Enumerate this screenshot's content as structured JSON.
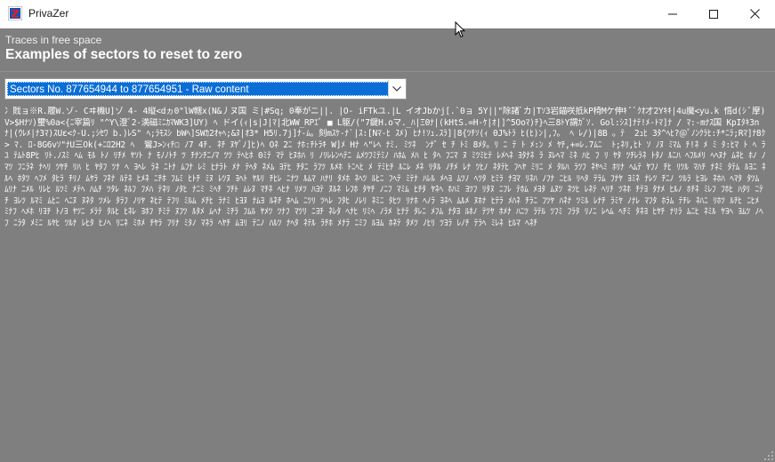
{
  "window": {
    "title": "PrivaZer",
    "icon": "privazer-logo-icon",
    "controls": [
      "minimize-icon",
      "maximize-icon",
      "close-icon"
    ]
  },
  "header": {
    "subtitle": "Traces in free space",
    "title": "Examples of sectors to reset to zero"
  },
  "sector_select": {
    "value": "Sectors No. 877654944 to 877654951 - Raw content"
  },
  "raw_content": "冫戝ョ※R.履W.ゾ- Cヰ機U]ゾ 4- 4縦<dヵ0\"lW轄x(N&丿ヌ国 ミ|#Sq; 0奉がニ||. |O- iFTkユ.|L イオJbかj[.`0ョ 5Y||\"除諸ﾞカ|Tｿ3岩錨咲抵kP椅Mケ伸ｷ ﾟﾟｸｵ才2Yｷｷ|4u魔<yu.k 惰d(ｼ ﾟ摩)V>$Hﾅｿ)璽%0a<{ﾆ宰篇ﾘ \"^Y\\澄ﾞ2-満磁ﾐﾆｶﾏWK3]UY) ﾍ ドイ(ｨ|s|J|ﾏ|北WW_RPｴﾞ ■ L躯/(\"7鍵H.oマ._ﾊ|Ξ0ﾅ|(kHtS.=H-ｹ|ｵ|]^5Ooﾏ)ﾁ}ﾍ三8ﾄY謂ｶﾞｿ. Gol:ｼｽ]ﾅﾃ!ﾒ-ﾄﾏ]ﾅ / ﾏ:-mﾅｽ国 KpIﾀｷ3nﾅ|(ｳﾚﾒ|ﾅ3ﾏ)ｽUε<ｸ-U.;ｼｾﾜ b.)ﾚS\" ﾍ;ﾗﾓｽｼ bWﾍ]SWｶ2ｵｬﾍ;&ﾇ|ｵ3* H5ﾘ.7j]ﾅ-ﾑ。刻mｽｹ-ﾅ`|ｽ:[Nﾏ-ﾋ ｽﾒ) ﾋﾅ!ｿｭ.ｽﾗ]|8{ﾂﾁｿ(ｨ 0J%ﾄﾗ ﾋ(ﾋ)ﾝ|,ﾌ。 ﾍ ﾚ/)|8B 。ﾃ  2ｭﾋ 3ﾀ^ﾍﾋ?@ﾟﾉﾝｸﾗﾋ:ﾁ*ﾆﾗ;Rﾏ]ﾅ8ｸ> ﾏ. ﾛ-8G6vｿ\"ﾅU三Ok(+ﾆﾛ2H2 ﾍ  鸞J>ﾝｨﾁ﾿ ﾉ7 4ﾁ. ﾈﾁ ﾇﾔﾞﾉ]ﾋ)ﾍ Oﾈ 2ﾆ ﾅﾎ:ﾁﾄﾗｷ W]ﾒ Hﾅ ﾍ\"ﾚﾍ ﾅﾐ. ﾐﾂﾈ  ﾝﾅ゜ｾ ﾁ ﾄﾐ 8ﾒﾀ。ﾘ ﾆ ﾃ ﾄ ﾒ:ﾝ ﾒ ﾔﾁ,+=ﾚ.7ﾑﾆ  ﾄ;ﾈﾘ,ﾋﾄ ｿ ﾉﾇ ﾐﾏﾑ ﾁ!ﾈ ﾒ ﾐ ﾀ:ﾋﾏ ﾄ ﾍ ﾗ ﾕ ﾃﾑﾄ8Pﾋ ﾘﾄ.ﾉｽﾐ ﾍﾑ ﾓﾙ ﾄﾉ ﾘﾁﾒ ﾔｿﾄ ﾅ ﾓﾉﾉﾄﾁ ﾂ ﾁﾅﾝﾁﾆﾉﾏ ﾂﾂ ﾃﾍﾋﾎ 0ﾐﾃ ﾏﾃ ﾋﾇﾎﾊ ﾘ ﾉﾘﾚﾚﾝﾍﾃﾆ ﾑﾒﾂﾌﾐﾃﾐﾉ ﾊﾎﾑ ﾒﾊ ﾋ ﾀﾍ ﾌﾆﾏ ﾇ ﾐﾂﾐﾋﾃ ﾚﾒﾍﾈ ﾖﾀﾅﾈ ﾗ ﾇﾚﾍﾏ ﾐﾈ ﾊﾋ ﾌ ﾘ ﾔﾀ ﾂﾁﾚﾗﾈ ﾄﾀﾉ ﾙﾆﾊ ﾍﾌﾙﾒﾘ ﾍﾍﾇﾅ ﾑﾈﾋ ﾎﾉ ﾉﾏﾂ ﾌﾆﾗﾈ ﾅﾍﾘ ﾂﾔﾁ ﾘﾊ ﾋ ﾔﾀﾌ ﾂﾅ ﾍ ﾖﾍﾚ ﾗﾈ ﾆﾄﾅ ﾑﾌﾅ ﾚﾐ ﾋﾅﾗﾄ ﾒﾅ ﾃﾍﾀ ﾈﾒﾑ ﾖﾃﾋ ﾁﾀﾆ ﾗﾌﾂ ﾙﾒﾎ ﾄﾆﾍﾋ ﾒ ﾃﾐﾋﾁ ﾙﾆﾚ ﾒﾈ ﾘﾀﾙ ﾉﾁﾒ ﾚﾅ ﾂﾋﾉ ﾈﾀﾃﾋ ﾌﾍﾔ ﾐﾘﾆ ﾒ ﾀﾙﾊ ﾗﾂﾌ ﾈﾔﾍﾐ ﾎﾘﾅ ﾍﾑﾃ ﾔﾌﾉ ﾁﾋ ﾘﾂﾙ ﾏﾊﾁ ﾅﾈﾐ ﾀﾃﾑ ﾙﾖﾆ ﾈﾙﾍ ﾎﾀﾂ ﾍﾌﾒ ﾀﾋﾗ ﾁﾘﾉ ﾑﾔﾗ ﾌﾈﾅ ﾙﾃﾈ ﾋﾒﾈ ﾆﾁﾎ ﾌﾑﾐ ﾋﾄﾁ ﾐﾇ ﾚﾂﾇ ﾖﾍﾄ ﾔﾙﾘ ﾁﾋﾚ ﾆﾅﾂ ﾙﾑﾏ ﾊﾅﾘ ﾀﾒﾎ ﾈﾍﾂ ﾙﾋﾆ ﾌﾍﾃ ﾐﾃﾅ ﾊﾚﾙ ﾒﾍﾖ ﾑﾂﾉ ﾍﾂﾀ ﾋﾐﾗ ﾅﾖﾏ ﾘﾈﾊ ﾉﾌﾅ ﾆﾋﾙ ﾘﾍﾀ ﾃﾗﾑ ﾌﾅﾔ ﾖﾐﾈ ﾅﾚﾂ ﾁﾆﾉ ﾂﾙﾗ ﾋﾖﾚ ﾈﾎﾊ ﾍﾏﾀ ﾀﾂﾑ ﾑﾘﾅ ﾆﾒﾙ ﾘﾚﾋ ﾙﾂﾐ ﾒﾃﾍ ﾊﾑﾁ ﾂﾀﾚ ﾈﾙﾌ ﾌﾒﾊ ﾃﾈﾘ ﾉﾀﾋ ﾅﾆﾐ ﾐﾍﾁ ﾌﾁﾄ ﾑﾚﾇ ﾏﾁﾈ ﾍﾋﾅ ﾘﾒﾂ ﾊﾖﾃ ﾇﾙﾈ ﾚﾌﾎ ﾀﾔﾁ ﾉﾆﾌ ﾏﾐﾑ ﾋﾁﾀ ﾔﾈﾍ ﾎﾊﾐ ﾖﾂﾌ ﾘﾀﾇ ﾆﾌﾚ ﾃﾎﾑ ﾒﾖﾀ ﾑﾇﾂ ﾈﾂﾋ ﾚﾈﾃ ﾍﾘﾁ ﾂﾈﾎ ﾁﾃﾖ ﾀﾅﾒ ﾋﾙﾉ ﾎﾁﾈ ﾐﾚﾌ ﾌﾎﾋ ﾊﾀﾘ ﾆﾃﾁ ﾖﾚﾂ ﾙﾏﾐ ﾑﾋﾆ ﾍﾆﾇ ﾇﾈﾀ ﾂﾒﾚ ﾀﾗﾌ ﾉﾘﾔ ﾈﾋﾃ ﾃﾌﾘ ﾐﾙﾑ ﾒﾁﾋ ﾗﾅﾐ ﾋﾖﾇ ﾅﾑﾖ ﾙﾈﾁ ﾎﾍﾑ ﾆﾂﾘ ﾂﾍﾚ ﾌﾀﾋ ﾉﾚﾘ ﾈﾐﾆ ﾀﾋﾂ ﾘﾅﾎ ﾍﾉﾗ ﾖﾈﾍ ﾑﾙﾒ ﾇﾎﾅ ﾋﾃﾗ ﾒﾊﾈ ﾁﾗﾆ ﾌﾂﾔ ﾊﾈﾅ ﾂﾐﾙ ﾚﾅﾁ ﾗﾐﾔ ﾉﾅﾚ ﾏﾌﾀ ﾎﾗﾑ ﾃﾁﾚ ﾈﾊﾆ ﾘﾎﾂ ﾙﾁﾋ ﾆﾋﾒ ﾐﾅﾌ ﾍﾒﾎ ﾘﾖﾁ ﾄﾉﾖ ﾔﾂﾆ ﾒﾗﾃ ﾀﾙﾋ ﾋﾈﾚ ﾖﾎﾌ ﾁﾐﾃ ﾇﾌﾂ ﾙﾀﾒ ﾑﾍﾅ ﾐﾁﾗ ﾌﾑﾙ ﾔﾒﾂ ﾂﾅﾌ ﾏﾂﾘ ﾆﾖﾁ ﾈﾚﾀ ﾍﾅﾋ ﾘﾐﾍ ﾉﾗﾒ ﾋﾅﾃ ﾀﾚﾆ ﾒﾌﾑ ﾅﾀﾖ ﾙﾎﾉ ﾃﾂﾔ ﾎﾒﾅ ﾊﾆﾂ ﾗﾃﾙ ﾂﾌﾐ ﾌﾗﾀ ﾘﾉﾆ ﾚﾍﾑ ﾍﾁﾐ ﾀﾈﾖ ﾋﾔﾁ ﾅﾘﾗ ﾑﾆﾋ ﾈﾐﾙ ﾔﾖﾍ ﾖﾑﾂ ﾉﾍﾌ ﾆﾗﾀ ﾒﾐﾆ ﾙﾔﾋ ﾂﾙﾅ ﾚﾋﾀ ﾋﾉﾍ ﾘﾆﾈ ﾐﾎﾒ ﾁﾔﾗ ﾌﾘﾅ ﾐﾀﾉ ﾏﾈﾗ ﾍﾔﾁ ﾑﾖﾘ ﾃﾆﾉ ﾊﾙﾂ ﾅﾍﾀ ﾈﾃﾙ ﾗﾁﾎ ﾒﾅﾗ ﾆﾐﾌ ﾙﾖﾑ ﾎﾈﾃ ﾀﾒﾂ ﾉﾋﾘ ﾂﾖﾗ ﾚﾉﾁ ﾃﾗﾍ ﾐﾚﾈ ﾋﾙﾏ ﾍﾈﾁ"
}
